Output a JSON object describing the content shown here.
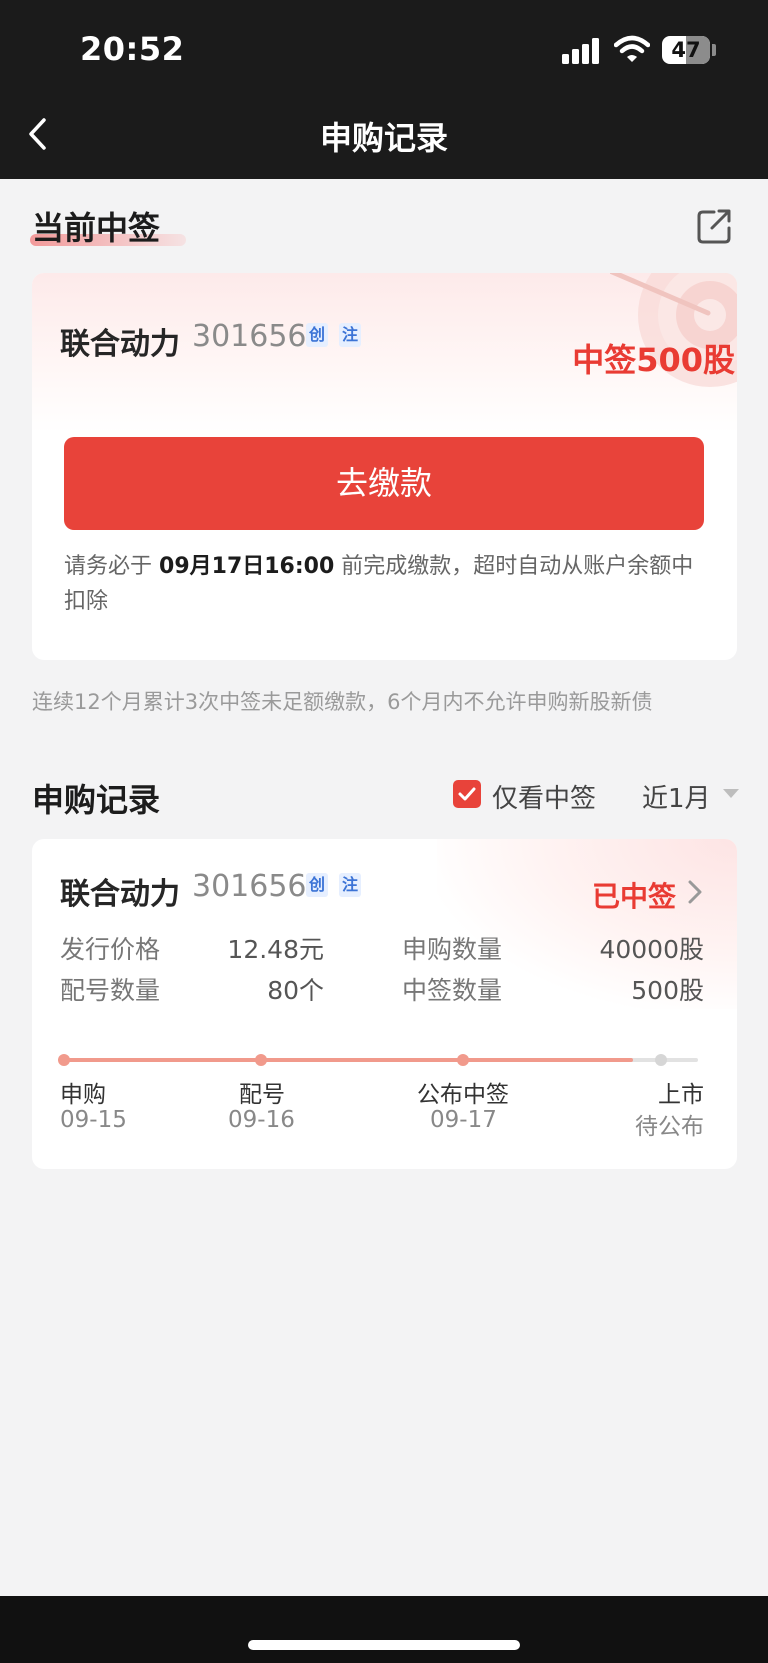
{
  "status_bar": {
    "time": "20:52",
    "battery": "47"
  },
  "nav": {
    "title": "申购记录"
  },
  "current_win": {
    "section_title": "当前中签",
    "stock_name": "联合动力",
    "stock_code": "301656",
    "tags": [
      "创",
      "注"
    ],
    "won_text": "中签500股",
    "pay_button": "去缴款",
    "notice_prefix": "请务必于",
    "notice_deadline": "09月17日16:00",
    "notice_suffix": "前完成缴款，超时自动从账户余额中扣除"
  },
  "warning_text": "连续12个月累计3次中签未足额缴款，6个月内不允许申购新股新债",
  "records": {
    "section_title": "申购记录",
    "filter_label": "仅看中签",
    "filter_checked": true,
    "period": "近1月",
    "items": [
      {
        "stock_name": "联合动力",
        "stock_code": "301656",
        "tags": [
          "创",
          "注"
        ],
        "status": "已中签",
        "issue_price_label": "发行价格",
        "issue_price": "12.48元",
        "apply_qty_label": "申购数量",
        "apply_qty": "40000股",
        "alloc_no_label": "配号数量",
        "alloc_no": "80个",
        "win_qty_label": "中签数量",
        "win_qty": "500股",
        "steps": [
          {
            "label": "申购",
            "date": "09-15",
            "done": true
          },
          {
            "label": "配号",
            "date": "09-16",
            "done": true
          },
          {
            "label": "公布中签",
            "date": "09-17",
            "done": true
          },
          {
            "label": "上市",
            "date": "待公布",
            "done": false
          }
        ]
      }
    ]
  },
  "colors": {
    "accent_red": "#e8433a",
    "topbar": "#1b1b1b",
    "tag_blue": "#3b73d6"
  }
}
